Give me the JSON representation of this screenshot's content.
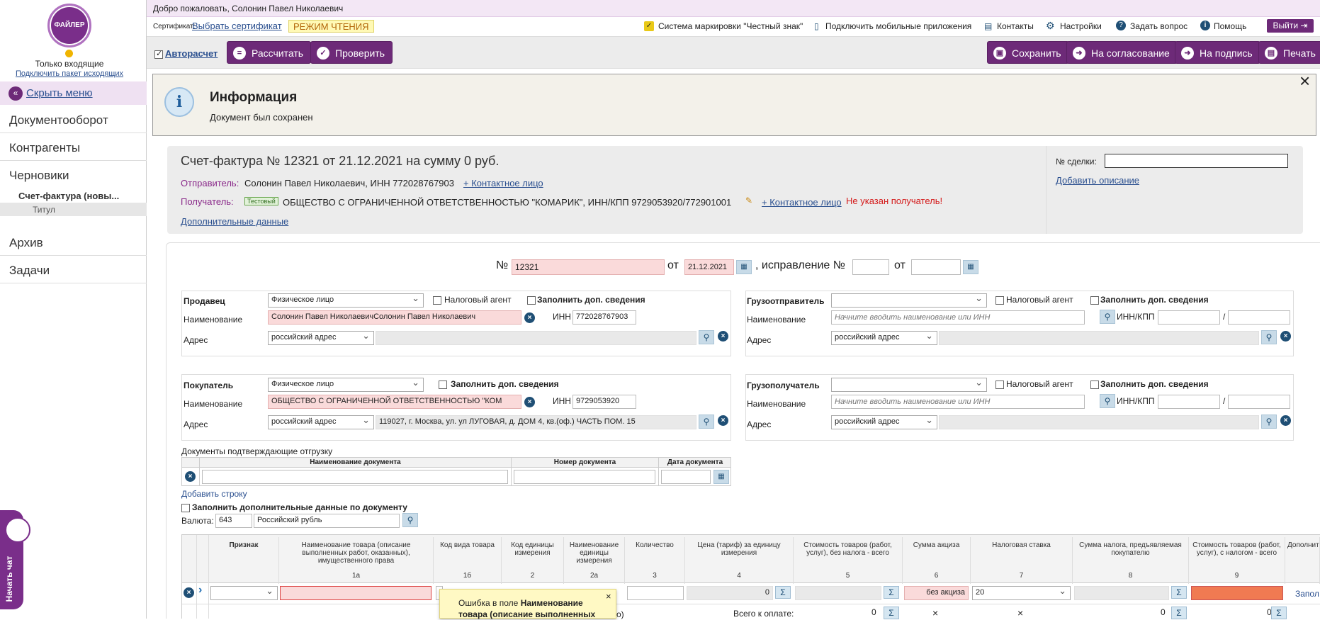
{
  "sidebar": {
    "logo_text": "ФАЙЛЕР",
    "incoming_only": "Только входящие",
    "connect_package": "Подключить пакет исходящих",
    "hide_menu": "Скрыть меню",
    "items": [
      {
        "label": "Документооборот"
      },
      {
        "label": "Контрагенты"
      },
      {
        "label": "Черновики"
      },
      {
        "label": "Архив"
      },
      {
        "label": "Задачи"
      }
    ],
    "sub_item": "Счет-фактура (новы...",
    "sub_sub_item": "Титул",
    "chat_label": "Начать чат"
  },
  "header": {
    "welcome": "Добро пожаловать, Солонин Павел Николаевич",
    "cert_label": "Сертификат:",
    "cert_link": "Выбрать сертификат",
    "readonly_badge": "РЕЖИМ ЧТЕНИЯ",
    "links": [
      {
        "label": "Система маркировки \"Честный знак\"",
        "icon": "check-badge-icon"
      },
      {
        "label": "Подключить мобильные приложения",
        "icon": "phone-icon"
      },
      {
        "label": "Контакты",
        "icon": "book-icon"
      },
      {
        "label": "Настройки",
        "icon": "gear-icon"
      },
      {
        "label": "Задать вопрос",
        "icon": "question-icon"
      },
      {
        "label": "Помощь",
        "icon": "info-icon"
      }
    ],
    "logout": "Выйти"
  },
  "toolbar": {
    "autocalc": "Авторасчет",
    "calculate": "Рассчитать",
    "check": "Проверить",
    "save": "Сохранить",
    "approve": "На согласование",
    "sign": "На подпись",
    "print": "Печать"
  },
  "info": {
    "title": "Информация",
    "message": "Документ был сохранен"
  },
  "doc": {
    "title": "Счет-фактура № 12321 от 21.12.2021 на сумму 0 руб.",
    "sender_label": "Отправитель:",
    "sender": "Солонин Павел Николаевич, ИНН 772028767903",
    "contact_link": "+ Контактное лицо",
    "receiver_label": "Получатель:",
    "test_badge": "Тестовый",
    "receiver": "ОБЩЕСТВО С ОГРАНИЧЕННОЙ ОТВЕТСТВЕННОСТЬЮ \"КОМАРИК\", ИНН/КПП 9729053920/772901001",
    "receiver_error": "Не указан получатель!",
    "extra_data": "Дополнительные данные",
    "deal_label": "№ сделки:",
    "add_description": "Добавить описание"
  },
  "form": {
    "num_label": "№",
    "num_value": "12321",
    "from_label": "от",
    "date_value": "21.12.2021",
    "correction_label": ", исправление №",
    "from_label2": "от",
    "seller": {
      "title": "Продавец",
      "type": "Физическое лицо",
      "tax_agent": "Налоговый агент",
      "fill_extra": "Заполнить доп. сведения",
      "name_label": "Наименование",
      "name_value": "Солонин Павел НиколаевичСолонин Павел Николаевич",
      "inn_label": "ИНН",
      "inn_value": "772028767903",
      "addr_label": "Адрес",
      "addr_type": "российский адрес"
    },
    "shipper": {
      "title": "Грузоотправитель",
      "tax_agent": "Налоговый агент",
      "fill_extra": "Заполнить доп. сведения",
      "name_label": "Наименование",
      "name_placeholder": "Начните вводить наименование или ИНН",
      "innkpp_label": "ИНН/КПП",
      "addr_label": "Адрес",
      "addr_type": "российский адрес"
    },
    "buyer": {
      "title": "Покупатель",
      "type": "Физическое лицо",
      "fill_extra": "Заполнить доп. сведения",
      "name_label": "Наименование",
      "name_value": "ОБЩЕСТВО С ОГРАНИЧЕННОЙ ОТВЕТСТВЕННОСТЬЮ \"КОМ",
      "inn_label": "ИНН",
      "inn_value": "9729053920",
      "addr_label": "Адрес",
      "addr_type": "российский адрес",
      "addr_value": "119027, г. Москва, ул. ул ЛУГОВАЯ, д. ДОМ 4, кв.(оф.) ЧАСТЬ ПОМ. 15"
    },
    "consignee": {
      "title": "Грузополучатель",
      "tax_agent": "Налоговый агент",
      "fill_extra": "Заполнить доп. сведения",
      "name_label": "Наименование",
      "name_placeholder": "Начните вводить наименование или ИНН",
      "innkpp_label": "ИНН/КПП",
      "addr_label": "Адрес",
      "addr_type": "российский адрес"
    },
    "shipment_docs": {
      "title": "Документы подтверждающие отгрузку",
      "col_name": "Наименование документа",
      "col_number": "Номер документа",
      "col_date": "Дата документа",
      "add_row": "Добавить строку"
    },
    "fill_additional": "Заполнить дополнительные данные по документу",
    "currency_label": "Валюта:",
    "currency_code": "643",
    "currency_name": "Российский рубль"
  },
  "goods_table": {
    "columns": [
      {
        "label": "Признак",
        "num": ""
      },
      {
        "label": "Наименование товара (описание выполненных работ, оказанных), имущественного права",
        "num": "1а"
      },
      {
        "label": "Код вида товара",
        "num": "1б"
      },
      {
        "label": "Код единицы измерения",
        "num": "2"
      },
      {
        "label": "Наименование единицы измерения",
        "num": "2а"
      },
      {
        "label": "Количество",
        "num": "3"
      },
      {
        "label": "Цена (тариф) за единицу измерения",
        "num": "4"
      },
      {
        "label": "Стоимость товаров (работ, услуг), без налога - всего",
        "num": "5"
      },
      {
        "label": "Сумма акциза",
        "num": "6"
      },
      {
        "label": "Налоговая ставка",
        "num": "7"
      },
      {
        "label": "Сумма налога, предъявляемая покупателю",
        "num": "8"
      },
      {
        "label": "Стоимость товаров (работ, услуг), с налогом - всего",
        "num": "9"
      },
      {
        "label": "Дополнительные данные товара",
        "num": ""
      }
    ],
    "row": {
      "price": "0",
      "excise": "без акциза",
      "rate": "20",
      "fill_link": "Запол"
    },
    "total_label": "Всего к оплате:",
    "total_5": "0",
    "total_x1": "×",
    "total_x2": "×",
    "total_8": "0",
    "total_9": "0",
    "partial_text": "о)"
  },
  "tooltip": {
    "prefix": "Ошибка в поле ",
    "field_line1": "Наименование",
    "field_line2": "товара (описание выполненных"
  }
}
